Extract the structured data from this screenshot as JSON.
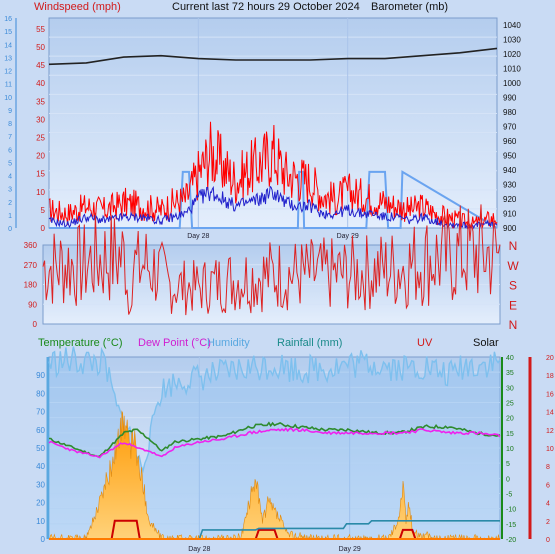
{
  "header": {
    "windspeed_label": "Windspeed (mph)",
    "title": "Current last 72 hours 29 October 2024",
    "barometer_label": "Barometer (mb)"
  },
  "labels": {
    "temperature": "Temperature (°C)",
    "dewpoint": "Dew Point (°C)",
    "humidity": "Humidity",
    "rainfall": "Rainfall (mm)",
    "uv": "UV",
    "solar": "Solar",
    "day28": "Day 28",
    "day29": "Day 29"
  },
  "colors": {
    "background": "#c9dbf4",
    "plot_bg_top": "#b4cdee",
    "plot_bg_bottom": "#e4eefc",
    "wind_gust": "#ff0000",
    "wind_avg": "#2222cc",
    "rain_rate": "#6aa4f0",
    "barometer": "#222222",
    "direction": "#dd2222",
    "temperature": "#2e8b2e",
    "dewpoint": "#ee22ee",
    "humidity": "#7ec0ee",
    "rainfall": "#2a8aa8",
    "uv": "#cc0000",
    "solar": "#f5a623",
    "windspeed_text": "#d21a1a",
    "dewpoint_text": "#d020d0",
    "temp_text": "#1a8a1a",
    "rain_text": "#1a8a8a"
  },
  "chart_data": [
    {
      "type": "line",
      "name": "wind-barometer",
      "x_range_hours": [
        0,
        72
      ],
      "x_tick_labels": [
        "Day 28",
        "Day 29"
      ],
      "left_axis": {
        "label": "Windspeed (mph)",
        "ylim": [
          0,
          58
        ],
        "ticks": [
          0,
          5,
          10,
          15,
          20,
          25,
          30,
          35,
          40,
          45,
          50,
          55
        ]
      },
      "left_outer_axis": {
        "ylim": [
          0,
          16
        ],
        "ticks": [
          0,
          1,
          2,
          3,
          4,
          5,
          6,
          7,
          8,
          9,
          10,
          11,
          12,
          13,
          14,
          15,
          16
        ]
      },
      "right_axis": {
        "label": "Barometer (mb)",
        "ylim": [
          900,
          1045
        ],
        "ticks": [
          900,
          910,
          920,
          930,
          940,
          950,
          960,
          970,
          980,
          990,
          1000,
          1010,
          1020,
          1030,
          1040
        ]
      },
      "series": [
        {
          "key": "gust",
          "x": [
            0,
            3,
            6,
            9,
            12,
            15,
            18,
            20,
            22,
            24,
            26,
            28,
            30,
            32,
            34,
            36,
            38,
            40,
            42,
            44,
            46,
            48,
            50,
            52,
            54,
            56,
            58,
            60,
            62,
            64,
            66,
            68,
            70,
            72
          ],
          "values": [
            5,
            4,
            6,
            5,
            7,
            6,
            5,
            7,
            8,
            15,
            21,
            17,
            13,
            16,
            18,
            21,
            15,
            14,
            13,
            9,
            8,
            10,
            9,
            8,
            7,
            6,
            5,
            6,
            4,
            3,
            2,
            1,
            2,
            3
          ]
        },
        {
          "key": "avg",
          "x": [
            0,
            3,
            6,
            9,
            12,
            15,
            18,
            20,
            22,
            24,
            26,
            28,
            30,
            32,
            34,
            36,
            38,
            40,
            42,
            44,
            46,
            48,
            50,
            52,
            54,
            56,
            58,
            60,
            62,
            64,
            66,
            68,
            70,
            72
          ],
          "values": [
            2,
            1,
            3,
            2,
            3,
            3,
            2,
            3,
            4,
            8,
            10,
            8,
            6,
            7,
            8,
            10,
            7,
            6,
            6,
            4,
            4,
            5,
            4,
            4,
            3,
            3,
            2,
            3,
            2,
            1,
            1,
            0.5,
            1,
            1
          ]
        },
        {
          "key": "rain_rate",
          "x": [
            0,
            21,
            21.5,
            22.5,
            23,
            40,
            40.2,
            40.8,
            41,
            51,
            51.5,
            54,
            54.5,
            56.5,
            56.8,
            72
          ],
          "values": [
            0,
            0,
            15.5,
            15.5,
            0,
            0,
            15.5,
            15.5,
            0,
            0,
            15.5,
            15.5,
            0,
            0,
            15.5,
            0
          ]
        },
        {
          "key": "barometer",
          "x": [
            0,
            6,
            12,
            18,
            24,
            30,
            36,
            42,
            48,
            54,
            60,
            66,
            72
          ],
          "values": [
            1013,
            1014,
            1018,
            1019,
            1017,
            1016,
            1016,
            1016,
            1017,
            1017,
            1019,
            1021,
            1024
          ]
        }
      ]
    },
    {
      "type": "line",
      "name": "wind-direction",
      "x_range_hours": [
        0,
        72
      ],
      "ylim": [
        0,
        360
      ],
      "left_ticks": [
        0,
        90,
        180,
        270,
        360
      ],
      "right_labels": [
        "N",
        "W",
        "S",
        "E",
        "N"
      ],
      "series": [
        {
          "key": "direction",
          "x": [
            0,
            2,
            4,
            6,
            8,
            10,
            12,
            13,
            13.2,
            13.4,
            14,
            15,
            16,
            18,
            20,
            24,
            28,
            32,
            36,
            40,
            44,
            48,
            52,
            56,
            58,
            60,
            62,
            64,
            66,
            68,
            70,
            72
          ],
          "values": [
            265,
            260,
            275,
            260,
            290,
            300,
            305,
            300,
            360,
            0,
            280,
            250,
            275,
            240,
            175,
            165,
            190,
            210,
            225,
            225,
            225,
            228,
            240,
            255,
            270,
            290,
            300,
            290,
            320,
            320,
            320,
            310
          ]
        }
      ]
    },
    {
      "type": "line",
      "name": "temperature-humidity-rain",
      "x_range_hours": [
        0,
        72
      ],
      "humidity_axis": {
        "ylim": [
          0,
          100
        ],
        "ticks": [
          0,
          10,
          20,
          30,
          40,
          50,
          60,
          70,
          80,
          90
        ]
      },
      "temp_axis": {
        "ylim": [
          -20,
          40
        ],
        "ticks": [
          -20,
          -15,
          -10,
          -5,
          0,
          5,
          10,
          15,
          20,
          25,
          30,
          35,
          40
        ]
      },
      "uv_axis": {
        "ylim": [
          0,
          20
        ],
        "ticks": [
          0,
          2,
          4,
          6,
          8,
          10,
          12,
          14,
          16,
          18,
          20
        ]
      },
      "series": [
        {
          "key": "humidity",
          "x": [
            0,
            4,
            8,
            9,
            10,
            11,
            12,
            13,
            14,
            15,
            16,
            17,
            18,
            20,
            24,
            28,
            32,
            36,
            40,
            44,
            48,
            52,
            56,
            60,
            62,
            64,
            66,
            68,
            72
          ],
          "values": [
            97,
            98,
            97,
            95,
            82,
            70,
            64,
            58,
            45,
            40,
            53,
            72,
            82,
            86,
            89,
            91,
            94,
            96,
            93,
            94,
            96,
            97,
            94,
            95,
            92,
            90,
            95,
            96,
            97
          ]
        },
        {
          "key": "temperature",
          "x": [
            0,
            4,
            8,
            12,
            14,
            16,
            18,
            20,
            24,
            28,
            32,
            36,
            40,
            44,
            48,
            52,
            56,
            60,
            64,
            68,
            72
          ],
          "values": [
            13,
            10,
            7,
            15,
            16,
            13,
            9,
            12,
            13,
            14,
            17,
            18,
            17,
            16,
            16,
            15,
            15,
            17,
            17,
            15,
            14
          ]
        },
        {
          "key": "dewpoint",
          "x": [
            0,
            4,
            8,
            12,
            14,
            16,
            18,
            20,
            24,
            28,
            32,
            36,
            40,
            44,
            48,
            52,
            56,
            60,
            64,
            68,
            72
          ],
          "values": [
            12,
            9,
            7,
            12,
            10,
            9,
            7,
            10,
            12,
            13,
            15,
            16,
            16,
            15,
            15,
            15,
            15,
            16,
            15,
            15,
            14
          ]
        },
        {
          "key": "rainfall",
          "x": [
            0,
            24,
            24.5,
            33,
            33.5,
            47,
            47.5,
            51,
            51.5,
            72
          ],
          "values": [
            -20,
            -20,
            -17,
            -17,
            -16.5,
            -16.5,
            -15,
            -15,
            -14,
            -14
          ]
        },
        {
          "key": "solar",
          "x": [
            0,
            6,
            8,
            10,
            11,
            12,
            12.5,
            13,
            13.5,
            14,
            15,
            16,
            18,
            30,
            31,
            32,
            33,
            34,
            35,
            36,
            37,
            38,
            42,
            54,
            55,
            56,
            56.5,
            57,
            57.5,
            58,
            59,
            62,
            72
          ],
          "values": [
            0,
            0,
            4,
            8,
            11,
            13,
            12,
            9,
            12,
            9,
            6,
            2,
            0,
            0,
            1,
            4,
            7,
            2,
            4,
            3,
            2,
            0.5,
            0,
            0,
            1,
            3,
            6,
            2,
            4,
            1,
            0.5,
            0,
            0
          ]
        },
        {
          "key": "uv",
          "x": [
            0,
            10,
            10.5,
            14,
            14.5,
            33,
            33.5,
            36,
            36.5,
            56,
            56.5,
            58,
            58.5,
            72
          ],
          "values": [
            0,
            0,
            2,
            2,
            0,
            0,
            1,
            1,
            0,
            0,
            1,
            1,
            0,
            0
          ]
        }
      ]
    }
  ]
}
